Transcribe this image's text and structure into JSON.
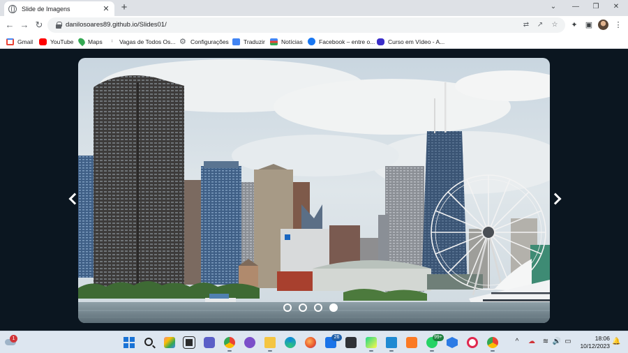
{
  "browser": {
    "tab_title": "Slide de Imagens",
    "tab_close": "✕",
    "new_tab": "+",
    "window_controls": {
      "minimize": "⌄",
      "restore": "—",
      "maximize": "❐",
      "close": "✕"
    },
    "nav": {
      "back": "←",
      "forward": "→",
      "reload": "↻"
    },
    "url": "danilosoares89.github.io/Slides01/",
    "omnibox_icons": [
      "translate-icon",
      "share-icon",
      "star-icon"
    ],
    "toolbar_icons": [
      "extensions-icon",
      "side-panel-icon",
      "profile-avatar",
      "menu-icon"
    ],
    "bookmarks": [
      {
        "label": "Gmail",
        "icon": "gmail-icon",
        "color": "#ea4335"
      },
      {
        "label": "YouTube",
        "icon": "youtube-icon",
        "color": "#ff0000"
      },
      {
        "label": "Maps",
        "icon": "maps-icon",
        "color": "#34a853"
      },
      {
        "label": "Vagas de Todos Os...",
        "icon": "info-icon",
        "color": "#5f6368"
      },
      {
        "label": "Configurações",
        "icon": "gear-icon",
        "color": "#5f6368"
      },
      {
        "label": "Traduzir",
        "icon": "translate-icon",
        "color": "#4285f4"
      },
      {
        "label": "Notícias",
        "icon": "news-icon",
        "color": "#1a73e8"
      },
      {
        "label": "Facebook – entre o...",
        "icon": "facebook-icon",
        "color": "#1877f2"
      },
      {
        "label": "Curso em Vídeo - A...",
        "icon": "cursoemvideo-icon",
        "color": "#3b2ec9"
      }
    ]
  },
  "slider": {
    "image": "chicago-skyline-navy-pier",
    "prev_label": "previous slide",
    "next_label": "next slide",
    "dots": [
      {
        "active": false
      },
      {
        "active": false
      },
      {
        "active": false
      },
      {
        "active": true
      }
    ],
    "active_index": 3
  },
  "taskbar": {
    "weather_badge": "1",
    "apps": [
      {
        "name": "start-button",
        "badge": ""
      },
      {
        "name": "search-icon",
        "badge": ""
      },
      {
        "name": "widgets-icon",
        "badge": ""
      },
      {
        "name": "task-view-icon",
        "badge": ""
      },
      {
        "name": "meet-icon",
        "badge": ""
      },
      {
        "name": "chrome-icon",
        "badge": ""
      },
      {
        "name": "github-desktop-icon",
        "badge": ""
      },
      {
        "name": "file-explorer-icon",
        "badge": ""
      },
      {
        "name": "edge-icon",
        "badge": ""
      },
      {
        "name": "firefox-icon",
        "badge": ""
      },
      {
        "name": "mail-icon",
        "badge": "26"
      },
      {
        "name": "store-icon",
        "badge": ""
      },
      {
        "name": "pycharm-icon",
        "badge": ""
      },
      {
        "name": "vscode-icon",
        "badge": ""
      },
      {
        "name": "xampp-icon",
        "badge": ""
      },
      {
        "name": "whatsapp-icon",
        "badge": "99+"
      },
      {
        "name": "hexagon-app-icon",
        "badge": ""
      },
      {
        "name": "opera-icon",
        "badge": ""
      },
      {
        "name": "chrome-active-icon",
        "badge": ""
      }
    ],
    "tray": {
      "chevron": "^",
      "wifi": "≋",
      "volume": "🔊",
      "battery": "▭"
    },
    "time": "18:06",
    "date": "10/12/2023",
    "bell": "🔔"
  }
}
